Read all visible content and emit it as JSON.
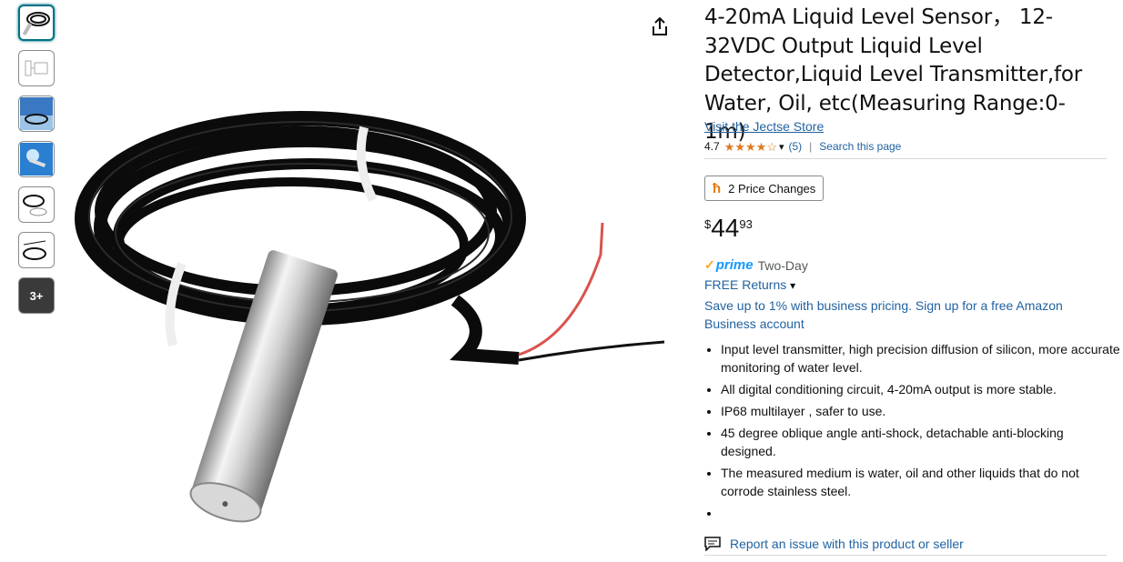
{
  "thumbnails": {
    "more_label": "3+"
  },
  "product": {
    "title": "4-20mA Liquid Level Sensor，  12-32VDC Output Liquid Level Detector,Liquid Level Transmitter,for Water, Oil, etc(Measuring Range:0-1m)",
    "store_link": "Visit the Jectse Store",
    "rating_value": "4.7",
    "rating_count": "(5)",
    "search_page": "Search this page",
    "price_changes": "2 Price Changes",
    "price_symbol": "$",
    "price_whole": "44",
    "price_fraction": "93",
    "prime_word": "prime",
    "prime_delivery": "Two-Day",
    "free_returns": "FREE Returns",
    "business_offer": "Save up to 1% with business pricing. Sign up for a free Amazon Business account",
    "bullets": [
      "Input level transmitter, high precision diffusion of silicon, more accurate monitoring of water level.",
      "All digital conditioning circuit, 4-20mA output is more stable.",
      "IP68 multilayer , safer to use.",
      "45 degree oblique angle anti-shock, detachable anti-blocking designed.",
      "The measured medium is water, oil and other liquids that do not corrode stainless steel.",
      ""
    ],
    "report_issue": "Report an issue with this product or seller"
  },
  "colors": {
    "link": "#2162a1",
    "star": "#de7921",
    "prime_blue": "#1399ff",
    "prime_check": "#ffa41c",
    "active_thumb_border": "#007185"
  },
  "icons": [
    "share-icon",
    "star-icon",
    "chevron-down-icon",
    "keepa-icon",
    "prime-check-icon",
    "report-icon"
  ]
}
